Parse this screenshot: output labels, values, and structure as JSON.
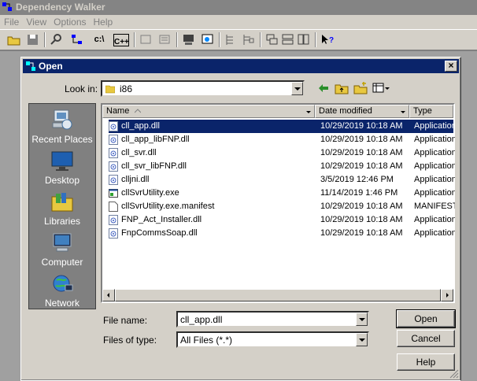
{
  "app": {
    "title": "Dependency Walker"
  },
  "menu": [
    "File",
    "View",
    "Options",
    "Help"
  ],
  "dialog": {
    "title": "Open",
    "close_label": "×",
    "look_in_label": "Look in:",
    "look_in_value": "i86",
    "file_name_label": "File name:",
    "file_name_value": "cll_app.dll",
    "files_of_type_label": "Files of type:",
    "files_of_type_value": "All Files (*.*)",
    "open_button": "Open",
    "cancel_button": "Cancel",
    "help_button": "Help"
  },
  "places": [
    "Recent Places",
    "Desktop",
    "Libraries",
    "Computer",
    "Network"
  ],
  "columns": [
    "Name",
    "Date modified",
    "Type"
  ],
  "files": [
    {
      "name": "cll_app.dll",
      "date": "10/29/2019 10:18 AM",
      "type": "Application",
      "icon": "dll-icon",
      "selected": true
    },
    {
      "name": "cll_app_libFNP.dll",
      "date": "10/29/2019 10:18 AM",
      "type": "Application",
      "icon": "dll-icon"
    },
    {
      "name": "cll_svr.dll",
      "date": "10/29/2019 10:18 AM",
      "type": "Application",
      "icon": "dll-icon"
    },
    {
      "name": "cll_svr_libFNP.dll",
      "date": "10/29/2019 10:18 AM",
      "type": "Application",
      "icon": "dll-icon"
    },
    {
      "name": "clljni.dll",
      "date": "3/5/2019 12:46 PM",
      "type": "Application",
      "icon": "dll-icon"
    },
    {
      "name": "cllSvrUtility.exe",
      "date": "11/14/2019 1:46 PM",
      "type": "Application",
      "icon": "exe-icon"
    },
    {
      "name": "cllSvrUtility.exe.manifest",
      "date": "10/29/2019 10:18 AM",
      "type": "MANIFEST",
      "icon": "file-icon"
    },
    {
      "name": "FNP_Act_Installer.dll",
      "date": "10/29/2019 10:18 AM",
      "type": "Application",
      "icon": "dll-icon"
    },
    {
      "name": "FnpCommsSoap.dll",
      "date": "10/29/2019 10:18 AM",
      "type": "Application",
      "icon": "dll-icon"
    }
  ],
  "colors": {
    "titlebar": "#0a246a",
    "face": "#d4d0c8",
    "selection": "#0a246a"
  }
}
